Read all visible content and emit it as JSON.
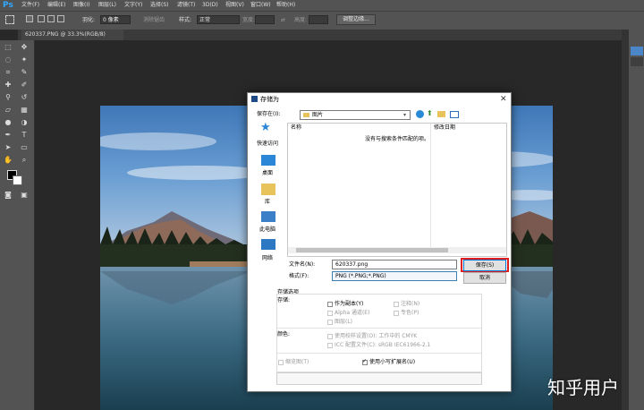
{
  "app": {
    "logo": "Ps"
  },
  "menubar": {
    "items": [
      "文件(F)",
      "编辑(E)",
      "图像(I)",
      "图层(L)",
      "文字(Y)",
      "选择(S)",
      "滤镜(T)",
      "3D(D)",
      "视图(V)",
      "窗口(W)",
      "帮助(H)"
    ]
  },
  "options": {
    "feather_label": "羽化:",
    "feather_value": "0 像素",
    "antialias_label": "消除锯齿",
    "style_label": "样式:",
    "style_value": "正常",
    "width_label": "宽度:",
    "height_label": "高度:",
    "refine_edge_label": "调整边缘..."
  },
  "document": {
    "tab_title": "620337.PNG @ 33.3%(RGB/8)"
  },
  "dialog": {
    "title": "存储为",
    "save_in_label": "保存在(I):",
    "save_in_value": "图片",
    "columns": {
      "name": "名称",
      "modified": "修改日期"
    },
    "empty_message": "没有与搜索条件匹配的项。",
    "sidebar": [
      "快速访问",
      "桌面",
      "库",
      "此电脑",
      "网络"
    ],
    "filename_label": "文件名(N):",
    "filename_value": "620337.png",
    "format_label": "格式(F):",
    "format_value": "PNG (*.PNG;*.PNG)",
    "save_button": "保存(S)",
    "cancel_button": "取消",
    "save_options_label": "存储选项",
    "storage_label": "存储:",
    "opt_as_copy": "作为副本(Y)",
    "opt_notes": "注释(N)",
    "opt_alpha": "Alpha 通道(E)",
    "opt_spot": "专色(P)",
    "opt_layers": "图层(L)",
    "color_label": "颜色:",
    "opt_proof": "使用校样设置(O):  工作中的 CMYK",
    "opt_icc": "ICC 配置文件(C):  sRGB IEC61966-2.1",
    "opt_thumbnail": "缩览图(T)",
    "opt_lowercase": "使用小写扩展名(U)"
  },
  "watermark": "知乎用户",
  "colors": {
    "ps_chrome": "#535353",
    "ps_blue": "#31a8ff",
    "highlight_red": "#e02020",
    "sky_blue": "#4a86c8"
  }
}
